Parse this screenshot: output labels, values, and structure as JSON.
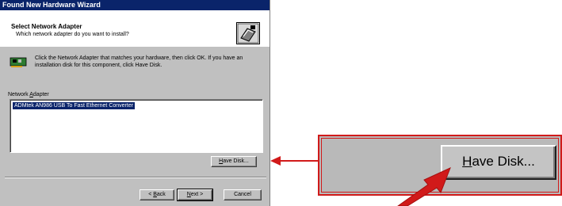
{
  "window": {
    "title": "Found New Hardware Wizard"
  },
  "header": {
    "title": "Select Network Adapter",
    "subtitle": "Which network adapter do you want to install?",
    "icon": "wizard-icon"
  },
  "instruction": {
    "icon": "network-card-icon",
    "text": "Click the Network Adapter that matches your hardware, then click OK. If you have an installation disk for this component, click Have Disk."
  },
  "list": {
    "label_prefix": "Network ",
    "label_accel": "A",
    "label_rest": "dapter",
    "items": [
      "ADMtek AN986 USB To Fast Ethernet Converter"
    ],
    "selected_index": 0
  },
  "buttons": {
    "have_disk": {
      "accel": "H",
      "rest": "ave Disk..."
    },
    "back": {
      "prefix": "< ",
      "accel": "B",
      "rest": "ack"
    },
    "next": {
      "accel": "N",
      "rest": "ext >"
    },
    "cancel": "Cancel"
  },
  "callout": {
    "have_disk": {
      "accel": "H",
      "rest": "ave Disk..."
    },
    "accent_color": "#d11a1a"
  }
}
